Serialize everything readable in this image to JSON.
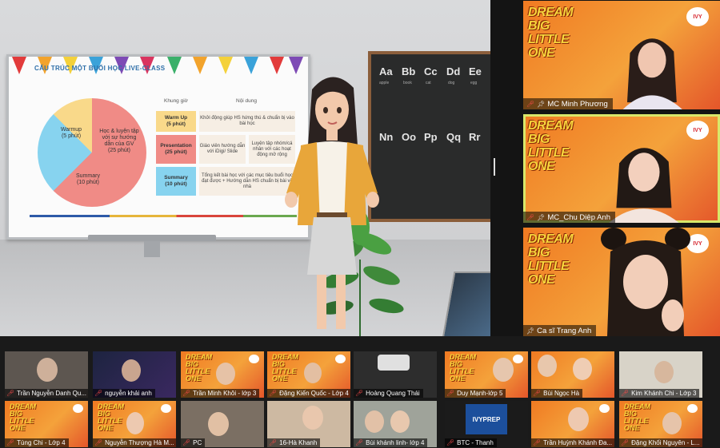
{
  "slide": {
    "title": "CẤU TRÚC MỘT BUỔI HỌC LIVE-CLASS",
    "pie": {
      "slices": [
        {
          "label": "Học & luyện tập với sự hướng dẫn của GV",
          "duration": "(25 phút)",
          "value": 25,
          "color": "#f08b86"
        },
        {
          "label": "Summary",
          "duration": "(10 phút)",
          "value": 10,
          "color": "#87d3ef"
        },
        {
          "label": "Warmup",
          "duration": "(5 phút)",
          "value": 5,
          "color": "#f9d98a"
        }
      ]
    },
    "table": {
      "col_time": "Khung giờ",
      "col_content": "Nội dung",
      "rows": [
        {
          "stage": "Warm Up",
          "time": "(5 phút)",
          "content": "Khởi động giúp HS hứng thú & chuẩn bị vào bài học",
          "color": "#f9d98a"
        },
        {
          "stage": "Presentation",
          "time": "(25 phút)",
          "content_a": "Giáo viên hướng dẫn với iDigi/ Slide",
          "content_b": "Luyện tập nhóm/cá nhân với các hoạt động mở rộng",
          "color": "#f08b86"
        },
        {
          "stage": "Summary",
          "time": "(10 phút)",
          "content": "Tổng kết bài học với các mục tiêu buổi học đạt được + Hướng dẫn HS chuẩn bị bài về nhà",
          "color": "#87d3ef"
        }
      ]
    }
  },
  "chalkboard": {
    "letters": [
      "Aa",
      "Bb",
      "Cc",
      "Dd",
      "Ee",
      "Nn",
      "Oo",
      "Pp",
      "Qq",
      "Rr"
    ],
    "words": [
      "apple",
      "book",
      "cat",
      "dog",
      "egg"
    ]
  },
  "event_logo": "DREAM BIG LITTLE ONE",
  "corner_logo": "IVY",
  "featured": [
    {
      "name": "MC Minh Phương",
      "active": false
    },
    {
      "name": "MC_Chu Diệp Anh",
      "active": true
    },
    {
      "name": "Ca sĩ Trang Anh",
      "active": false
    }
  ],
  "participants": [
    {
      "name": "Trần Nguyễn Danh Qu..."
    },
    {
      "name": "nguyễn khải anh"
    },
    {
      "name": "Trần Minh Khôi - lớp 3"
    },
    {
      "name": "Đặng Kiến Quốc - Lớp 4"
    },
    {
      "name": "Hoàng Quang Thái"
    },
    {
      "name": "Duy Mạnh-lớp 5"
    },
    {
      "name": "Bùi Ngọc Hà"
    },
    {
      "name": "Kim Khánh Chi - Lớp 3"
    },
    {
      "name": "Tùng Chi - Lớp 4"
    },
    {
      "name": "Nguyễn Thượng Hà M..."
    },
    {
      "name": "PC"
    },
    {
      "name": "16-Hà Khanh"
    },
    {
      "name": "Bùi khánh linh- lớp 4"
    },
    {
      "name": "BTC - Thanh"
    },
    {
      "name": "Trần Huỳnh Khánh Đa..."
    },
    {
      "name": "Đặng Khối Nguyên - L..."
    }
  ],
  "ivyprep_logo": "IVYPREP"
}
